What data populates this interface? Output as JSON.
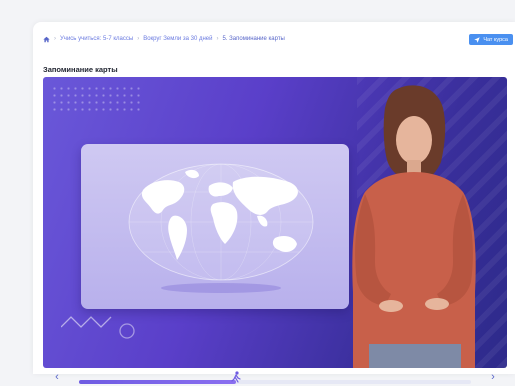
{
  "breadcrumb": {
    "items": [
      {
        "label": "Учись учиться: 5-7 классы"
      },
      {
        "label": "Вокруг Земли за 30 дней"
      }
    ],
    "current": "5. Запоминание карты"
  },
  "chat_button": {
    "label": "Чат курса"
  },
  "lesson": {
    "title": "Запоминание карты"
  },
  "player": {
    "progress_fraction": 0.4
  },
  "colors": {
    "accent": "#6f5ce2",
    "chat_button": "#4a90f0",
    "video_bg": "#5a3fc9"
  }
}
